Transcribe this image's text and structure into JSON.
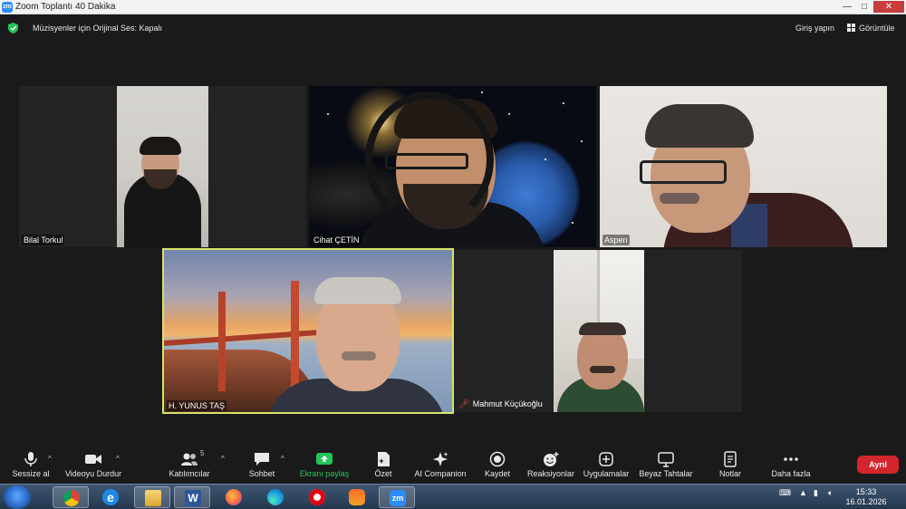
{
  "window": {
    "title": "Zoom Toplantı 40 Dakika",
    "app_icon": "zm"
  },
  "topbar": {
    "original_sound": "Müzisyenler için Orijinal Ses: Kapalı",
    "sign_in": "Giriş yapın",
    "view": "Görüntüle"
  },
  "participants": [
    {
      "name": "Bilal Torkul"
    },
    {
      "name": "Cihat ÇETİN"
    },
    {
      "name": "Aspen"
    },
    {
      "name": "H. YUNUS TAŞ",
      "active_speaker": true
    },
    {
      "name": "Mahmut Küçükoğlu",
      "muted": true
    }
  ],
  "toolbar": {
    "mute": "Sessize al",
    "stop_video": "Videoyu Durdur",
    "participants": "Katılımcılar",
    "participants_count": "5",
    "chat": "Sohbet",
    "share_screen": "Ekranı paylaş",
    "summary": "Özet",
    "ai_companion": "AI Companion",
    "record": "Kaydet",
    "reactions": "Reaksiyonlar",
    "apps": "Uygulamalar",
    "whiteboard": "Beyaz Tahtalar",
    "notes": "Notlar",
    "more": "Daha fazla",
    "leave": "Ayrıl"
  },
  "taskbar": {
    "apps": [
      "chrome-icon",
      "ie-icon",
      "explorer-icon",
      "word-icon",
      "firefox-icon",
      "edge-icon",
      "opera-icon",
      "brave-icon",
      "zoom-icon"
    ],
    "word_letter": "W",
    "zoom_letters": "zm",
    "time": "15:33",
    "date": "16.01.2026"
  },
  "colors": {
    "accent_green": "#24c45a",
    "active_speaker_border": "#d7e46a",
    "leave_red": "#d3262c",
    "zoom_blue": "#2d8cff"
  }
}
